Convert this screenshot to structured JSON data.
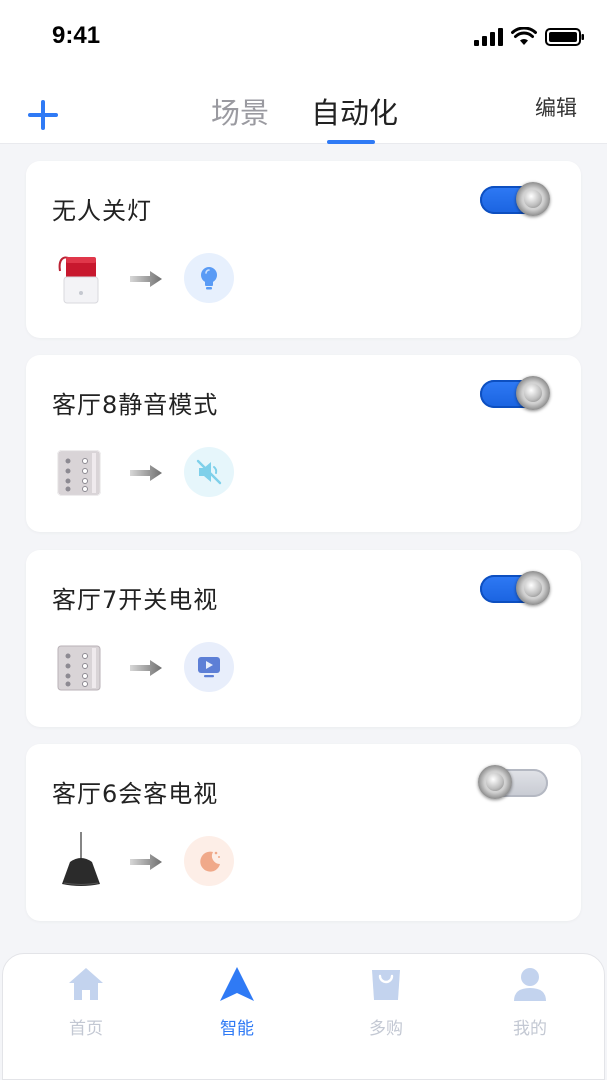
{
  "status_bar": {
    "time": "9:41"
  },
  "header": {
    "tabs": [
      {
        "label": "场景",
        "active": false
      },
      {
        "label": "自动化",
        "active": true
      }
    ],
    "edit_label": "编辑"
  },
  "automations": [
    {
      "title": "无人关灯",
      "enabled": true,
      "trigger_device": "alarm-siren-icon",
      "action": "light-bulb-icon"
    },
    {
      "title": "客厅8静音模式",
      "enabled": true,
      "trigger_device": "wall-switch-panel-icon",
      "action": "mute-icon"
    },
    {
      "title": "客厅7开关电视",
      "enabled": true,
      "trigger_device": "wall-switch-panel-icon",
      "action": "tv-icon"
    },
    {
      "title": "客厅6会客电视",
      "enabled": false,
      "trigger_device": "pendant-lamp-icon",
      "action": "moon-icon"
    }
  ],
  "tabbar": {
    "items": [
      {
        "label": "首页",
        "icon": "home-icon",
        "active": false
      },
      {
        "label": "智能",
        "icon": "navigation-arrow-icon",
        "active": true
      },
      {
        "label": "多购",
        "icon": "shopping-bag-icon",
        "active": false
      },
      {
        "label": "我的",
        "icon": "user-icon",
        "active": false
      }
    ]
  },
  "colors": {
    "accent": "#2f7af5",
    "background": "#f4f5f8",
    "inactive_tab": "#9a9aa0",
    "tabbar_inactive": "#c3c8d3"
  }
}
